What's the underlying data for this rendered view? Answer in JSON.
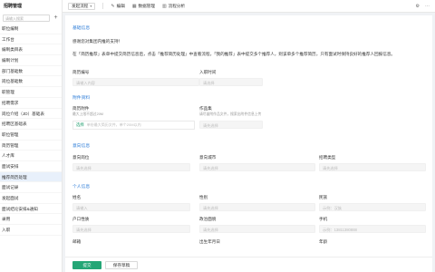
{
  "sidebar": {
    "brand": "招聘管理",
    "search_placeholder": "请输入搜索",
    "items": [
      {
        "label": "职位编制"
      },
      {
        "label": "工作台"
      },
      {
        "label": "编制类目表"
      },
      {
        "label": "编制计划"
      },
      {
        "label": "部门基础数"
      },
      {
        "label": "岗位基础数"
      },
      {
        "label": "职管理"
      },
      {
        "label": "招聘需求"
      },
      {
        "label": "岗位介绍（JD）基础表"
      },
      {
        "label": "招聘区基础表"
      },
      {
        "label": "职位管理"
      },
      {
        "label": "简历管理"
      },
      {
        "label": "人才库"
      },
      {
        "label": "面试安排"
      },
      {
        "label": "推荐简历处理",
        "active": true
      },
      {
        "label": "面试记录"
      },
      {
        "label": "发起面试"
      },
      {
        "label": "面试结论安排&通知"
      },
      {
        "label": "录用"
      },
      {
        "label": "入职"
      }
    ]
  },
  "topbar": {
    "select_value": "发起流程",
    "edit_label": "编辑",
    "data_label": "数据管理",
    "share_label": "流程分析"
  },
  "form": {
    "sec_basic": "基础信息",
    "notice_greeting": "感谢您对集团内推的支持！",
    "notice_body": "在「简历推荐」表单中提交简历信息后，点击「推荐简历处理」中查看流程，「我的推荐」表中提交多个推荐人，则该单多个推荐简历，只有面试时保持良好的推荐人回报信息。",
    "recommender_no_label": "简历编号",
    "recommender_no_placeholder": "请输入内容",
    "entry_time_label": "入职时间",
    "entry_time_placeholder": "请选择",
    "sec_attachments": "附件资料",
    "resume_label": "简历附件",
    "resume_hint": "最大上限不超过20M",
    "resume_select": "选择",
    "resume_upload_hint": "单份最大简历文件，单个20M以内",
    "works_label": "作品集",
    "works_hint": "请尽量附作品文件，搜索出附件信息上传",
    "works_placeholder": "请先选择",
    "sec_intent": "意向信息",
    "intent_pos_label": "意向岗位",
    "intent_pos_placeholder": "请先选择",
    "intent_city_label": "意向城市",
    "intent_city_placeholder": "请先选择",
    "recruit_type_label": "招聘类型",
    "recruit_type_placeholder": "请先选择",
    "sec_personal": "个人信息",
    "name_label": "姓名",
    "name_placeholder": "请输入",
    "gender_label": "性别",
    "gender_placeholder": "请先选择",
    "age_label": "民族",
    "age_placeholder": "示例：汉族",
    "hukou_label": "户口性质",
    "hukou_placeholder": "请先选择",
    "politics_label": "政治面貌",
    "politics_placeholder": "请先选择",
    "phone_label": "手机",
    "phone_placeholder": "示例：13811380888",
    "email_label": "邮箱",
    "birth_label": "出生年月日",
    "birthplace_label": "年龄"
  },
  "footer": {
    "submit_label": "提交",
    "draft_label": "保存草稿"
  }
}
